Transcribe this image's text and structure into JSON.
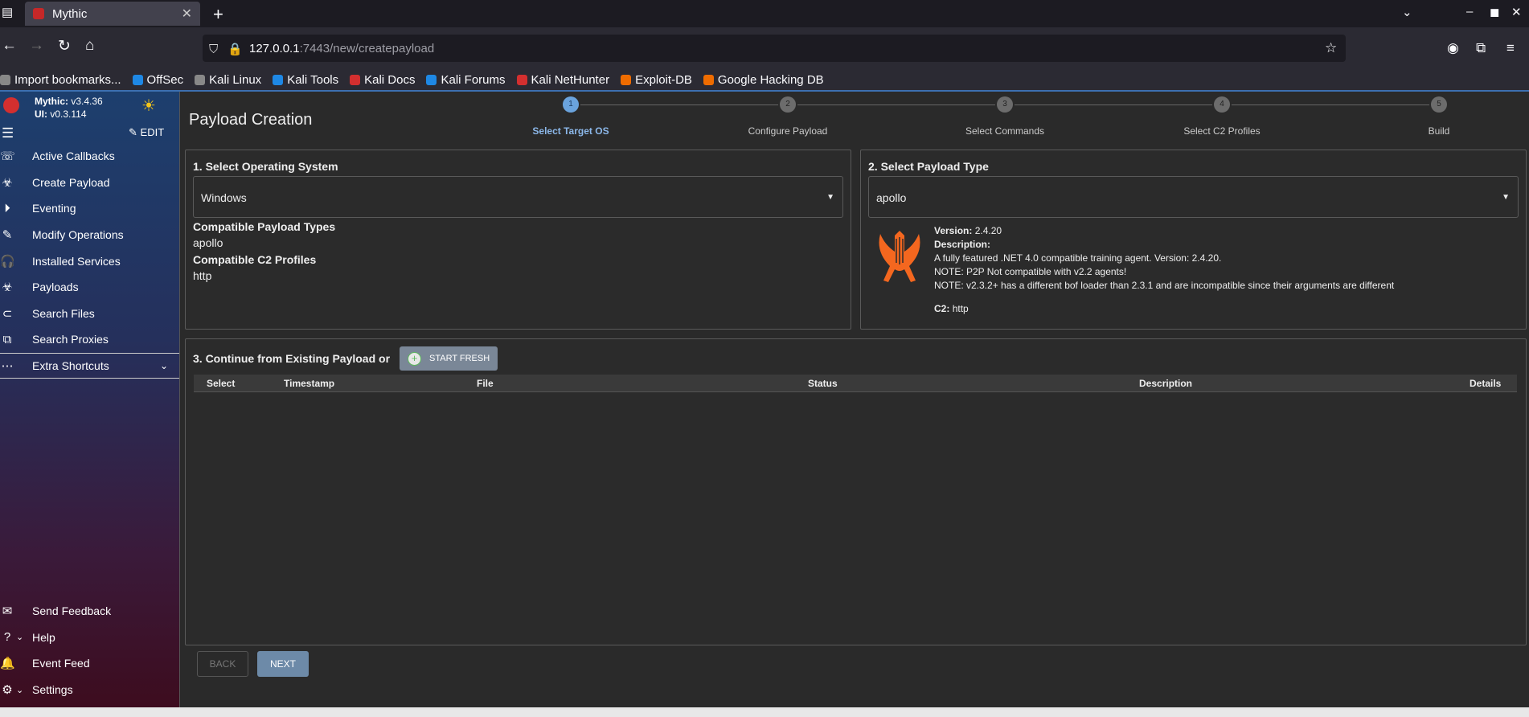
{
  "browser": {
    "tab_title": "Mythic",
    "url_host": "127.0.0.1",
    "url_rest": ":7443/new/createpayload",
    "bookmarks": [
      {
        "label": "Import bookmarks...",
        "color": "#888"
      },
      {
        "label": "OffSec",
        "color": "#1e88e5"
      },
      {
        "label": "Kali Linux",
        "color": "#888"
      },
      {
        "label": "Kali Tools",
        "color": "#1e88e5"
      },
      {
        "label": "Kali Docs",
        "color": "#d32f2f"
      },
      {
        "label": "Kali Forums",
        "color": "#1e88e5"
      },
      {
        "label": "Kali NetHunter",
        "color": "#d32f2f"
      },
      {
        "label": "Exploit-DB",
        "color": "#ef6c00"
      },
      {
        "label": "Google Hacking DB",
        "color": "#ef6c00"
      }
    ]
  },
  "sidebar": {
    "mythic_label": "Mythic:",
    "mythic_version": "v3.4.36",
    "ui_label": "UI:",
    "ui_version": "v0.3.114",
    "edit_label": "EDIT",
    "items": [
      {
        "label": "Active Callbacks",
        "icon": "phone-callback-icon"
      },
      {
        "label": "Create Payload",
        "icon": "biohazard-add-icon"
      },
      {
        "label": "Eventing",
        "icon": "play-circle-icon"
      },
      {
        "label": "Modify Operations",
        "icon": "pencil-icon"
      },
      {
        "label": "Installed Services",
        "icon": "headphones-icon"
      },
      {
        "label": "Payloads",
        "icon": "biohazard-icon"
      },
      {
        "label": "Search Files",
        "icon": "paperclip-icon"
      },
      {
        "label": "Search Proxies",
        "icon": "socks-icon"
      },
      {
        "label": "Extra Shortcuts",
        "icon": "more-horizontal-icon"
      }
    ],
    "bottom": [
      {
        "label": "Send Feedback",
        "icon": "feedback-icon"
      },
      {
        "label": "Help",
        "icon": "help-icon"
      },
      {
        "label": "Event Feed",
        "icon": "bell-icon"
      },
      {
        "label": "Settings",
        "icon": "settings-icon"
      }
    ]
  },
  "page": {
    "title": "Payload Creation",
    "steps": [
      {
        "num": "1",
        "label": "Select Target OS"
      },
      {
        "num": "2",
        "label": "Configure Payload"
      },
      {
        "num": "3",
        "label": "Select Commands"
      },
      {
        "num": "4",
        "label": "Select C2 Profiles"
      },
      {
        "num": "5",
        "label": "Build"
      }
    ],
    "os_panel": {
      "title": "1. Select Operating System",
      "selected": "Windows",
      "compat_types_label": "Compatible Payload Types",
      "compat_types_value": "apollo",
      "compat_c2_label": "Compatible C2 Profiles",
      "compat_c2_value": "http"
    },
    "type_panel": {
      "title": "2. Select Payload Type",
      "selected": "apollo",
      "version_label": "Version:",
      "version_value": "2.4.20",
      "description_label": "Description:",
      "desc_line1": "A fully featured .NET 4.0 compatible training agent. Version: 2.4.20.",
      "desc_line2": "NOTE: P2P Not compatible with v2.2 agents!",
      "desc_line3": "NOTE: v2.3.2+ has a different bof loader than 2.3.1 and are incompatible since their arguments are different",
      "c2_label": "C2:",
      "c2_value": "http"
    },
    "existing_panel": {
      "title": "3. Continue from Existing Payload or",
      "start_fresh": "START FRESH",
      "columns": [
        "Select",
        "Timestamp",
        "File",
        "Status",
        "Description",
        "Details"
      ]
    },
    "back_label": "BACK",
    "next_label": "NEXT"
  },
  "colors": {
    "accent": "#6aa3dd",
    "harp": "#f4671f"
  }
}
